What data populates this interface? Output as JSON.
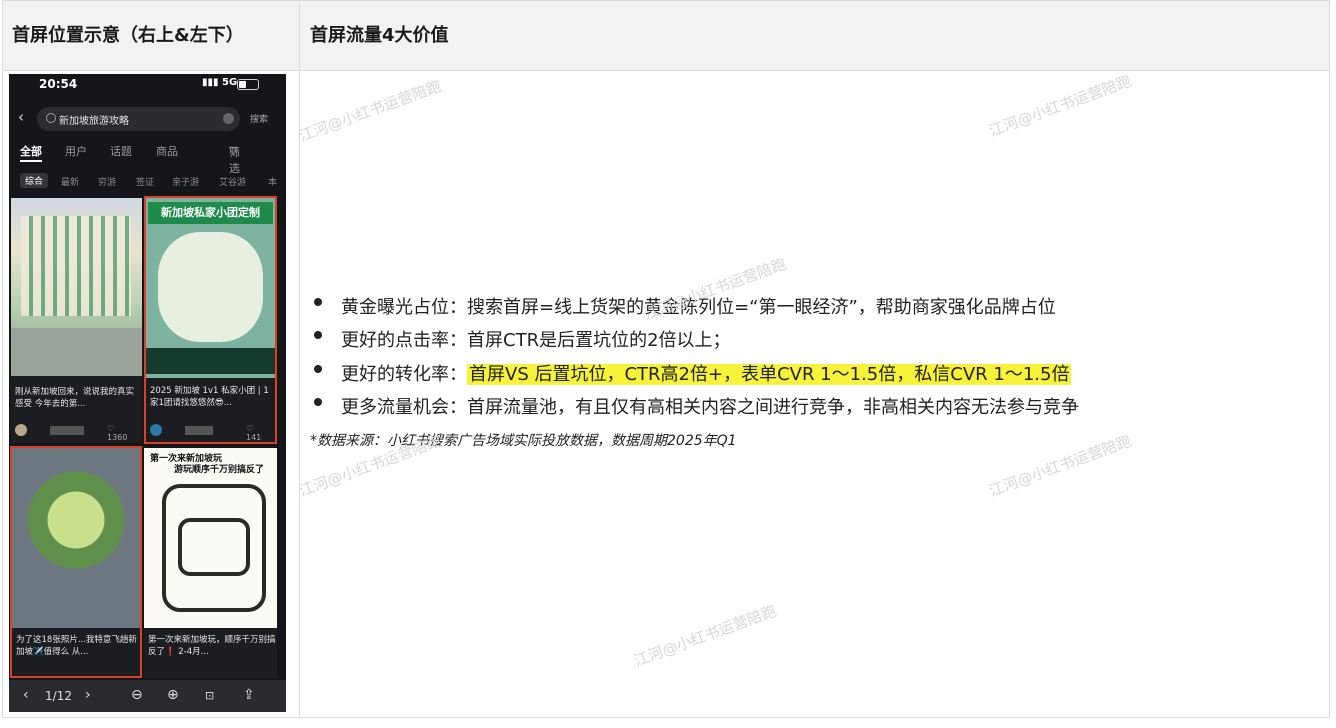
{
  "header": {
    "col1": "首屏位置示意（右上&左下）",
    "col2": "首屏流量4大价值"
  },
  "phone": {
    "time": "20:54",
    "signal": "5G",
    "search_query": "新加坡旅游攻略",
    "search_button": "搜索",
    "tabs": [
      "全部",
      "用户",
      "话题",
      "商品"
    ],
    "filter": "筛选",
    "chips": [
      "综合",
      "最新",
      "穷游",
      "签证",
      "亲子游",
      "艾谷游",
      "本"
    ],
    "cards": [
      {
        "caption": "刚从新加坡回来，说说我的真实感受 今年去的第...",
        "likes": "1360"
      },
      {
        "caption": "2025 新加坡 1v1 私家小团 | 1家1团请找悠悠然😎...",
        "likes": "141",
        "banner": "新加坡私家小团定制"
      },
      {
        "caption": "为了这18张照片...我特意飞趟新加坡✈️值得么 从..."
      },
      {
        "caption": "第一次来新加坡玩，顺序千万别搞反了❗️ 2-4月...",
        "poster_title": "第一次来新加坡玩",
        "poster_sub": "游玩顺序千万别搞反了"
      }
    ],
    "page": "1/12",
    "bottom_icons": [
      "zoom-out",
      "zoom-in",
      "actual-size",
      "share"
    ]
  },
  "bullets": [
    {
      "text": "黄金曝光占位：搜索首屏=线上货架的黄金陈列位=“第一眼经济”，帮助商家强化品牌占位"
    },
    {
      "text": "更好的点击率：首屏CTR是后置坑位的2倍以上；"
    },
    {
      "label": "更好的转化率：",
      "highlight": "首屏VS 后置坑位，CTR高2倍+，表单CVR 1～1.5倍，私信CVR 1～1.5倍"
    },
    {
      "text": "更多流量机会：首屏流量池，有且仅有高相关内容之间进行竞争，非高相关内容无法参与竞争"
    }
  ],
  "note": "*数据来源：小红书搜索广告场域实际投放数据，数据周期2025年Q1",
  "watermark": "江河@小红书运营陪跑",
  "colors": {
    "highlight": "#f6f23a",
    "card_border": "#d9412b",
    "header_bg": "#f2f2f2"
  }
}
